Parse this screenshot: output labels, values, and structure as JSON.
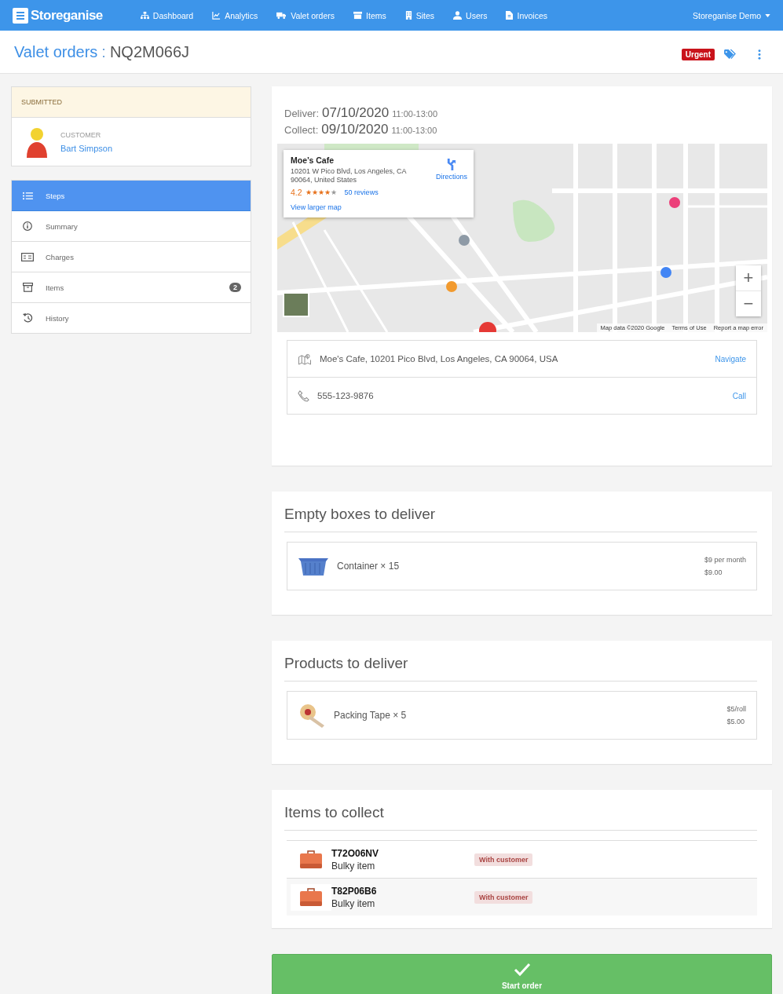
{
  "nav": {
    "brand": "Storeganise",
    "items": [
      {
        "label": "Dashboard"
      },
      {
        "label": "Analytics"
      },
      {
        "label": "Valet orders"
      },
      {
        "label": "Items"
      },
      {
        "label": "Sites"
      },
      {
        "label": "Users"
      },
      {
        "label": "Invoices"
      }
    ],
    "account": "Storeganise Demo"
  },
  "header": {
    "section": "Valet orders",
    "separator": ":",
    "order_id": "NQ2M066J",
    "tag": "Urgent"
  },
  "status": "SUBMITTED",
  "customer": {
    "label": "CUSTOMER",
    "name": "Bart Simpson"
  },
  "menu": [
    {
      "label": "Steps",
      "selected": true
    },
    {
      "label": "Summary",
      "selected": false
    },
    {
      "label": "Charges",
      "selected": false
    },
    {
      "label": "Items",
      "selected": false,
      "count": "2"
    },
    {
      "label": "History",
      "selected": false
    }
  ],
  "schedule": [
    {
      "label": "Deliver:",
      "date": "07/10/2020",
      "time": "11:00-13:00"
    },
    {
      "label": "Collect:",
      "date": "09/10/2020",
      "time": "11:00-13:00"
    }
  ],
  "map": {
    "place_card": {
      "title": "Moe’s Cafe",
      "address": "10201 W Pico Blvd, Los Angeles, CA 90064, United States",
      "rating": "4.2",
      "stars": 4,
      "reviews": "50 reviews",
      "directions": "Directions",
      "larger_map": "View larger map"
    },
    "zoom_in": "+",
    "zoom_out": "−",
    "footer": [
      "Map data ©2020 Google",
      "Terms of Use",
      "Report a map error"
    ]
  },
  "contact": [
    {
      "kind": "address",
      "text": "Moe's Cafe, 10201 Pico Blvd, Los Angeles, CA 90064, USA",
      "action": "Navigate"
    },
    {
      "kind": "phone",
      "text": "555-123-9876",
      "action": "Call"
    }
  ],
  "sections": [
    {
      "title": "Empty boxes to deliver",
      "lines": [
        {
          "kind": "container",
          "name": "Container × 15",
          "price": "$9 per month",
          "total": "$9.00"
        }
      ]
    },
    {
      "title": "Products to deliver",
      "lines": [
        {
          "kind": "tape",
          "name": "Packing Tape × 5",
          "price": "$5/roll",
          "total": "$5.00"
        }
      ]
    }
  ],
  "collect": {
    "title": "Items to collect",
    "items": [
      {
        "code": "T72O06NV",
        "type": "Bulky item",
        "status": "With customer"
      },
      {
        "code": "T82P06B6",
        "type": "Bulky item",
        "status": "With customer"
      }
    ]
  },
  "start_button": "Start order"
}
